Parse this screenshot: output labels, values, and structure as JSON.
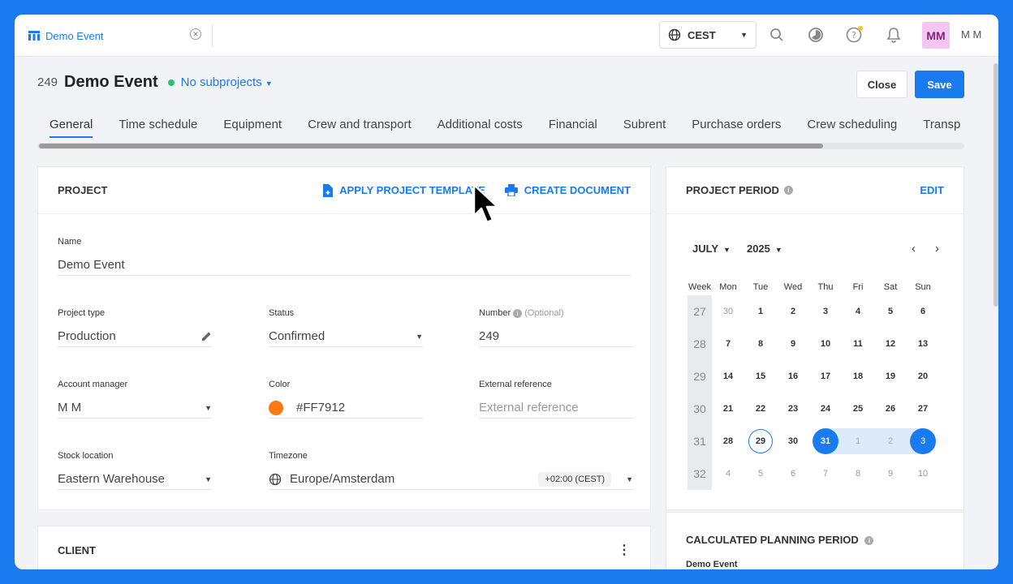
{
  "app": {
    "tab_title": "Demo Event",
    "timezone_short": "CEST",
    "avatar_initials": "MM",
    "user_name": "M M"
  },
  "project": {
    "number": "249",
    "title": "Demo Event",
    "subprojects_label": "No subprojects",
    "close_label": "Close",
    "save_label": "Save"
  },
  "tabs": [
    "General",
    "Time schedule",
    "Equipment",
    "Crew and transport",
    "Additional costs",
    "Financial",
    "Subrent",
    "Purchase orders",
    "Crew scheduling",
    "Transp"
  ],
  "project_card": {
    "heading": "PROJECT",
    "apply_template_label": "APPLY PROJECT TEMPLATE",
    "create_document_label": "CREATE DOCUMENT",
    "name_label": "Name",
    "name_value": "Demo Event",
    "type_label": "Project type",
    "type_value": "Production",
    "status_label": "Status",
    "status_value": "Confirmed",
    "number_label": "Number",
    "number_optional": "(Optional)",
    "number_value": "249",
    "manager_label": "Account manager",
    "manager_value": "M M",
    "color_label": "Color",
    "color_value": "#FF7912",
    "extref_label": "External reference",
    "extref_placeholder": "External reference",
    "stock_label": "Stock location",
    "stock_value": "Eastern Warehouse",
    "tz_label": "Timezone",
    "tz_value": "Europe/Amsterdam",
    "tz_offset": "+02:00 (CEST)"
  },
  "client_card": {
    "heading": "CLIENT"
  },
  "period_card": {
    "heading": "PROJECT PERIOD",
    "edit_label": "EDIT",
    "month": "JULY",
    "year": "2025",
    "weekdays": [
      "Week",
      "Mon",
      "Tue",
      "Wed",
      "Thu",
      "Fri",
      "Sat",
      "Sun"
    ],
    "weeks": [
      {
        "week": "27",
        "days": [
          "30",
          "1",
          "2",
          "3",
          "4",
          "5",
          "6"
        ]
      },
      {
        "week": "28",
        "days": [
          "7",
          "8",
          "9",
          "10",
          "11",
          "12",
          "13"
        ]
      },
      {
        "week": "29",
        "days": [
          "14",
          "15",
          "16",
          "17",
          "18",
          "19",
          "20"
        ]
      },
      {
        "week": "30",
        "days": [
          "21",
          "22",
          "23",
          "24",
          "25",
          "26",
          "27"
        ]
      },
      {
        "week": "31",
        "days": [
          "28",
          "29",
          "30",
          "31",
          "1",
          "2",
          "3"
        ]
      },
      {
        "week": "32",
        "days": [
          "4",
          "5",
          "6",
          "7",
          "8",
          "9",
          "10"
        ]
      }
    ]
  },
  "planning_card": {
    "heading": "CALCULATED PLANNING PERIOD",
    "project_name": "Demo Event"
  },
  "colors": {
    "accent": "#1a7bf0",
    "status_dot": "#2fbf71",
    "project_color": "#FF7912",
    "avatar_bg": "#f6c6f3"
  },
  "icons": [
    "calendar-app-icon",
    "close-tab-icon",
    "globe-icon",
    "search-icon",
    "pie-chart-icon",
    "help-icon",
    "bell-icon",
    "document-plus-icon",
    "printer-icon",
    "pencil-icon",
    "info-icon",
    "kebab-menu-icon",
    "mouse-cursor-icon"
  ]
}
